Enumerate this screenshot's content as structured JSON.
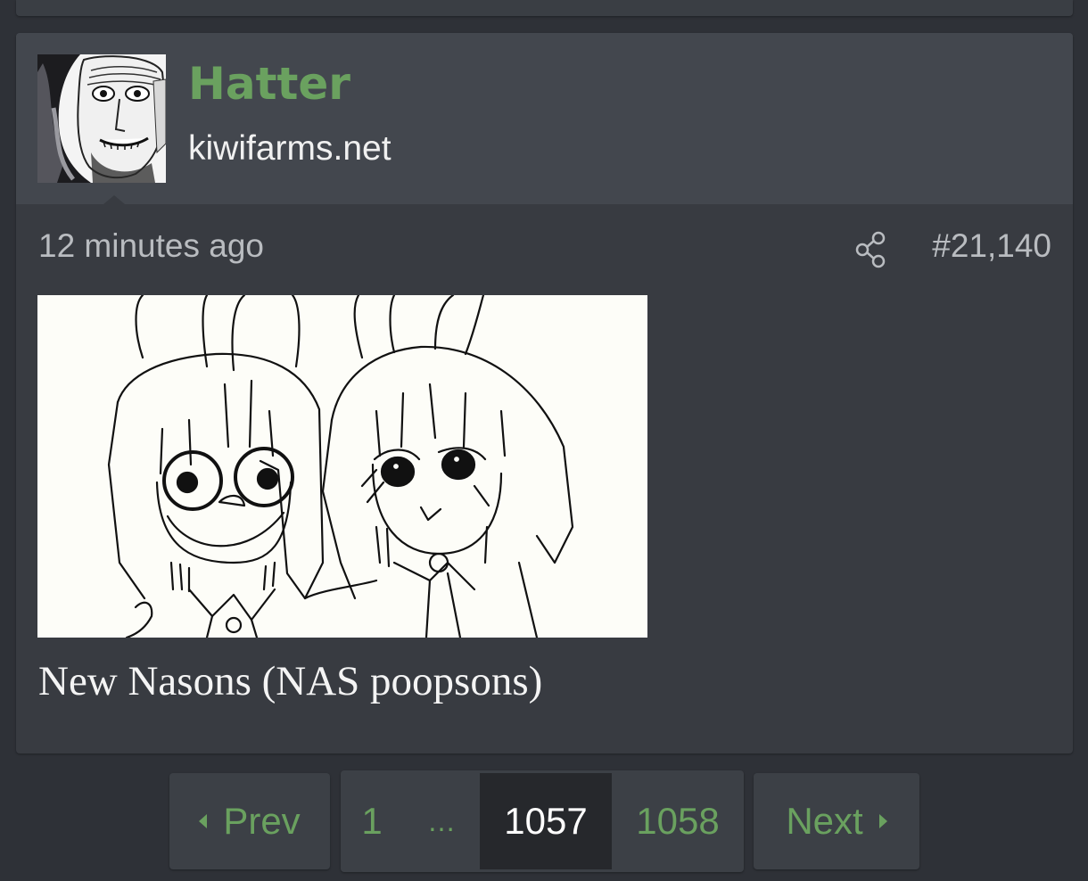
{
  "post": {
    "username": "Hatter",
    "user_title": "kiwifarms.net",
    "timestamp": "12 minutes ago",
    "post_number": "#21,140",
    "body_text": "New Nasons (NAS poopsons)"
  },
  "pagination": {
    "prev_label": "Prev",
    "first_page": "1",
    "ellipsis": "…",
    "current_page": "1057",
    "next_page_number": "1058",
    "next_label": "Next"
  },
  "colors": {
    "username": "#6aa15f",
    "link": "#6aa15f",
    "page_background": "#2e3137",
    "post_background": "#383b41",
    "header_background": "#43474e",
    "current_page_background": "#26282c"
  },
  "icons": {
    "share": "share-icon",
    "prev_arrow": "caret-left-icon",
    "next_arrow": "caret-right-icon"
  }
}
